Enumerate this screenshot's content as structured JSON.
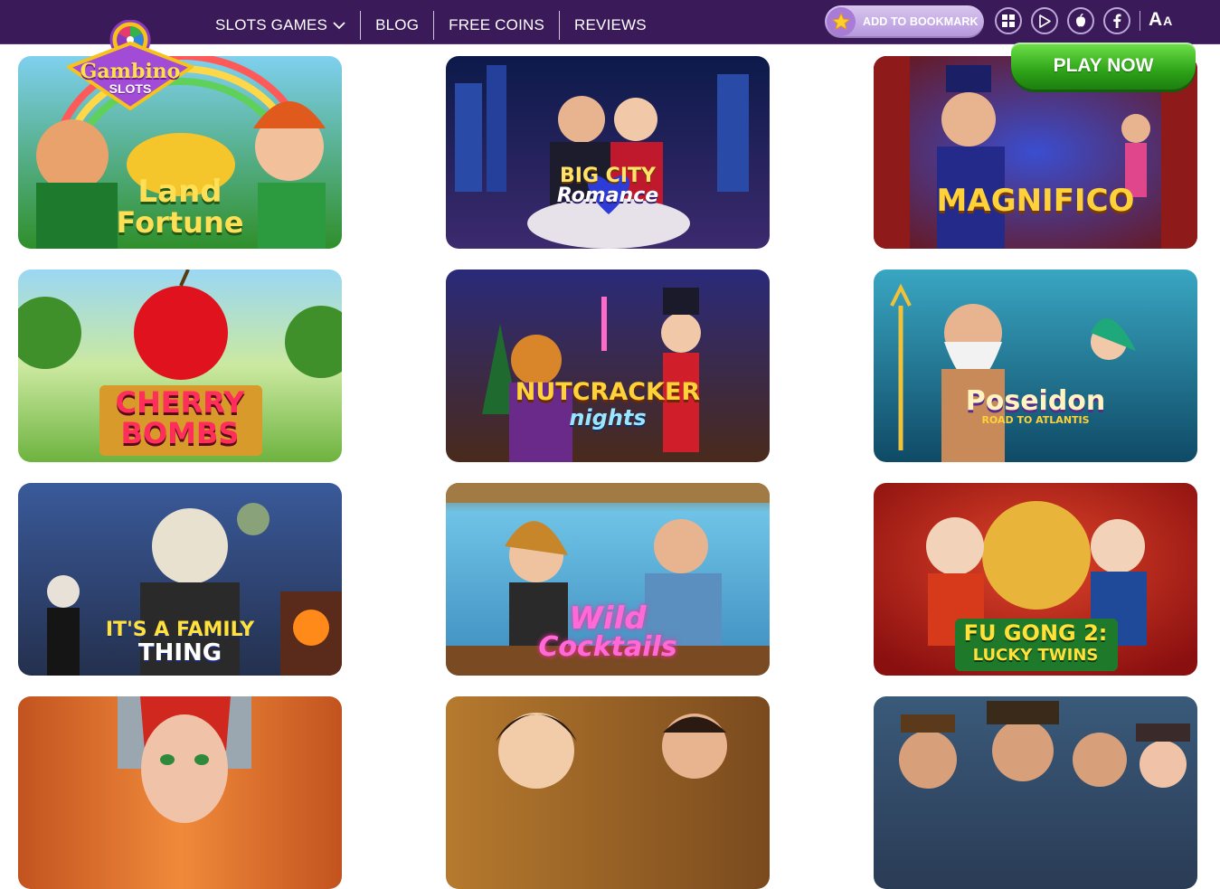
{
  "header": {
    "logo_text_top": "Gambino",
    "logo_text_bottom": "SLOTS",
    "nav": [
      {
        "label": "SLOTS GAMES"
      },
      {
        "label": "BLOG"
      },
      {
        "label": "FREE COINS"
      },
      {
        "label": "REVIEWS"
      }
    ],
    "bookmark_label": "ADD TO BOOKMARK",
    "platform_icons": [
      "windows-icon",
      "google-play-icon",
      "apple-icon",
      "facebook-icon"
    ],
    "font_size_big": "A",
    "font_size_small": "A",
    "play_now_label": "PLAY NOW"
  },
  "colors": {
    "topbar": "#3b1a5a",
    "play_green": "#2ea418",
    "bookmark": "#b596dc"
  },
  "games": [
    {
      "title_line1": "Land",
      "title_line2": "Fortune",
      "theme": "#2f8f2a"
    },
    {
      "title_line1": "BIG CITY",
      "title_line2": "Romance",
      "theme": "#1b2766"
    },
    {
      "title_line1": "MAGNIFICO",
      "title_line2": "",
      "theme": "#6a1414"
    },
    {
      "title_line1": "CHERRY",
      "title_line2": "BOMBS",
      "theme": "#6db33f"
    },
    {
      "title_line1": "NUTCRACKER",
      "title_line2": "nights",
      "theme": "#4a2a1c"
    },
    {
      "title_line1": "Poseidon",
      "title_line2": "ROAD TO ATLANTIS",
      "theme": "#1f6f86"
    },
    {
      "title_line1": "IT'S A FAMILY",
      "title_line2": "THING",
      "theme": "#24304e"
    },
    {
      "title_line1": "Wild",
      "title_line2": "Cocktails",
      "theme": "#3b8bbd"
    },
    {
      "title_line1": "FU GONG 2:",
      "title_line2": "LUCKY TWINS",
      "theme": "#b21a1a"
    },
    {
      "title_line1": "",
      "title_line2": "",
      "theme": "#c2531f"
    },
    {
      "title_line1": "",
      "title_line2": "",
      "theme": "#b67a2e"
    },
    {
      "title_line1": "",
      "title_line2": "",
      "theme": "#2a3b55"
    }
  ]
}
